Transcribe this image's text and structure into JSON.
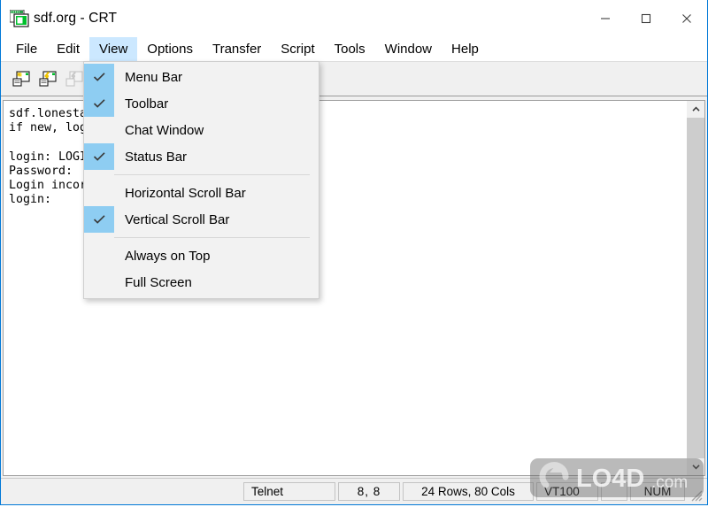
{
  "window": {
    "title": "sdf.org - CRT",
    "icon": "crt-terminal-icon",
    "accent_color": "#0078d7",
    "controls": {
      "minimize": "Minimize",
      "maximize": "Maximize",
      "close": "Close"
    }
  },
  "menu_bar": {
    "items": [
      {
        "label": "File",
        "active": false
      },
      {
        "label": "Edit",
        "active": false
      },
      {
        "label": "View",
        "active": true
      },
      {
        "label": "Options",
        "active": false
      },
      {
        "label": "Transfer",
        "active": false
      },
      {
        "label": "Script",
        "active": false
      },
      {
        "label": "Tools",
        "active": false
      },
      {
        "label": "Window",
        "active": false
      },
      {
        "label": "Help",
        "active": false
      }
    ]
  },
  "toolbar": {
    "buttons": [
      {
        "name": "connect-icon",
        "enabled": true
      },
      {
        "name": "connect-in-tab-icon",
        "enabled": true
      },
      {
        "name": "disconnect-icon",
        "enabled": false
      },
      {
        "name": "session-options-icon",
        "enabled": true
      },
      {
        "name": "global-options-icon",
        "enabled": true
      },
      {
        "name": "help-icon",
        "enabled": true
      },
      {
        "name": "tile-windows-icon",
        "enabled": false
      }
    ]
  },
  "view_menu": {
    "items": [
      {
        "label": "Menu Bar",
        "checked": true,
        "separator_after": false
      },
      {
        "label": "Toolbar",
        "checked": true,
        "separator_after": false
      },
      {
        "label": "Chat Window",
        "checked": false,
        "separator_after": false
      },
      {
        "label": "Status Bar",
        "checked": true,
        "separator_after": true
      },
      {
        "label": "Horizontal Scroll Bar",
        "checked": false,
        "separator_after": false
      },
      {
        "label": "Vertical Scroll Bar",
        "checked": true,
        "separator_after": true
      },
      {
        "label": "Always on Top",
        "checked": false,
        "separator_after": false
      },
      {
        "label": "Full Screen",
        "checked": false,
        "separator_after": false
      }
    ]
  },
  "terminal": {
    "lines": [
      "sdf.lonestar.org",
      "if new, login as 'new'",
      "",
      "login: LOGIN",
      "Password:",
      "Login incorrect, or unsupported terminal.",
      "login:"
    ]
  },
  "scrollbar": {
    "up_arrow": "scroll-up-arrow",
    "down_arrow": "scroll-down-arrow"
  },
  "status_bar": {
    "protocol": "Telnet",
    "cursor": "8,  8",
    "dimensions": "24 Rows,  80 Cols",
    "emulation": "VT100",
    "num_lock": "NUM"
  },
  "watermark": {
    "text": "LO4D",
    "suffix": ".com"
  }
}
